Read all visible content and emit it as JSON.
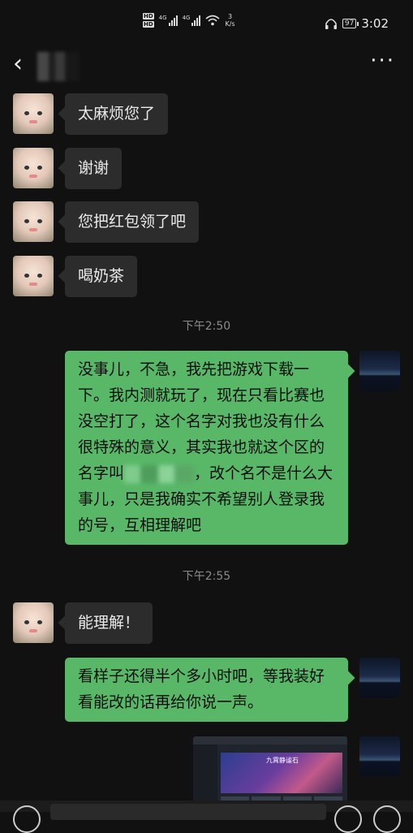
{
  "status_bar": {
    "hd1": "HD",
    "hd2": "HD",
    "net1": "4G",
    "net2": "4G",
    "speed_value": "3",
    "speed_unit": "K/s",
    "battery": "97",
    "time": "3:02"
  },
  "nav": {
    "back_icon": "chevron-left",
    "more_icon": "more-dots",
    "more_label": "···"
  },
  "messages": [
    {
      "side": "left",
      "text": "太麻烦您了"
    },
    {
      "side": "left",
      "text": "谢谢"
    },
    {
      "side": "left",
      "text": "您把红包领了吧"
    },
    {
      "side": "left",
      "text": "喝奶茶"
    },
    {
      "type": "time",
      "text": "下午2:50"
    },
    {
      "side": "right",
      "text_before_blur": "没事儿，不急，我先把游戏下载一下。我内测就玩了，现在只看比赛也没空打了，这个名字对我也没有什么很特殊的意义，其实我也就这个区的名字叫",
      "text_after_blur": "，改个名不是什么大事儿，只是我确实不希望别人登录我的号，互相理解吧"
    },
    {
      "type": "time",
      "text": "下午2:55"
    },
    {
      "side": "left",
      "text": "能理解！"
    },
    {
      "side": "right",
      "text": "看样子还得半个多小时吧，等我装好看能改的话再给你说一声。"
    },
    {
      "side": "right",
      "type": "image",
      "caption": "九霄静谧石"
    }
  ],
  "colors": {
    "background": "#111111",
    "bubble_left": "#2c2c2c",
    "bubble_right": "#58b868",
    "timestamp": "#8a8a8a"
  }
}
